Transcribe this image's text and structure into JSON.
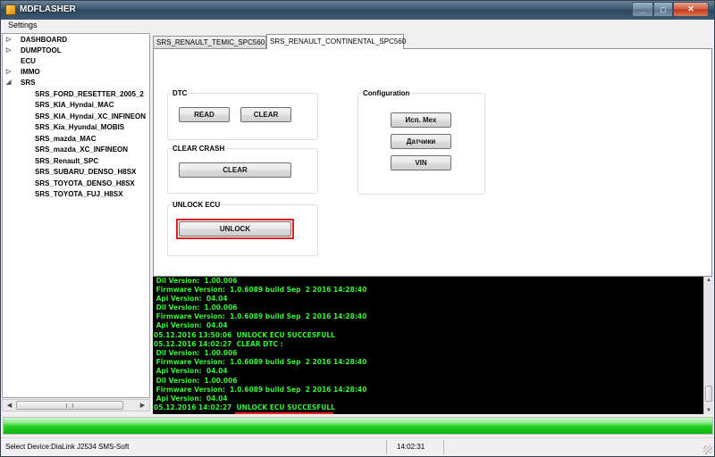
{
  "window": {
    "title": "MDFLASHER",
    "buttons": {
      "minimize": "_",
      "maximize": "□",
      "close": "✕"
    }
  },
  "menu": {
    "items": [
      "Settings"
    ]
  },
  "tree": {
    "top_items": [
      {
        "label": "DASHBOARD",
        "expanded": false
      },
      {
        "label": "DUMPTOOL",
        "expanded": false
      },
      {
        "label": "ECU",
        "expanded": false,
        "has_children": false
      },
      {
        "label": "IMMO",
        "expanded": false
      },
      {
        "label": "SRS",
        "expanded": true
      }
    ],
    "srs_children": [
      "SRS_FORD_RESETTER_2005_2",
      "SRS_KIA_Hyndai_MAC",
      "SRS_KIA_Hyndai_XC_INFINEON",
      "SRS_Kia_Hyundai_MOBIS",
      "SRS_mazda_MAC",
      "SRS_mazda_XC_INFINEON",
      "SRS_Renault_SPC",
      "SRS_SUBARU_DENSO_H8SX",
      "SRS_TOYOTA_DENSO_H8SX",
      "SRS_TOYOTA_FUJ_H8SX"
    ]
  },
  "tabs": [
    {
      "label": "SRS_RENAULT_TEMIC_SPC560",
      "active": false
    },
    {
      "label": "SRS_RENAULT_CONTINENTAL_SPC560",
      "active": true
    }
  ],
  "panel": {
    "dtc": {
      "title": "DTC",
      "read_label": "READ",
      "clear_label": "CLEAR"
    },
    "clear_crash": {
      "title": "CLEAR CRASH",
      "clear_label": "CLEAR"
    },
    "unlock": {
      "title": "UNLOCK ECU",
      "unlock_label": "UNLOCK"
    },
    "configuration": {
      "title": "Configuration",
      "buttons": [
        "Исп. Мех",
        "Датчики",
        "VIN"
      ]
    }
  },
  "log": {
    "lines": [
      " Dll Version:  1.00.006",
      " Firmware Version:  1.0.6089 build Sep  2 2016 14:28:40",
      " Api Version:  04.04",
      " Dll Version:  1.00.006",
      " Firmware Version:  1.0.6089 build Sep  2 2016 14:28:40",
      " Api Version:  04.04",
      "05.12.2016 13:50:06  UNLOCK ECU SUCCESFULL",
      "05.12.2016 14:02:27  CLEAR DTC :",
      " Dll Version:  1.00.006",
      " Firmware Version:  1.0.6089 build Sep  2 2016 14:28:40",
      " Api Version:  04.04",
      " Dll Version:  1.00.006",
      " Firmware Version:  1.0.6089 build Sep  2 2016 14:28:40",
      " Api Version:  04.04",
      "05.12.2016 14:02:27  UNLOCK ECU SUCCESFULL"
    ],
    "text_color": "#35f335",
    "background": "#000000"
  },
  "progress": {
    "fraction": 1.0,
    "color": "#1fcf1f"
  },
  "status": {
    "device": "Select Device:DiaLink J2534  SMS-Soft",
    "time": "14:02:31"
  },
  "colors": {
    "highlight": "#e02020",
    "titlebar": "#3d566c"
  }
}
